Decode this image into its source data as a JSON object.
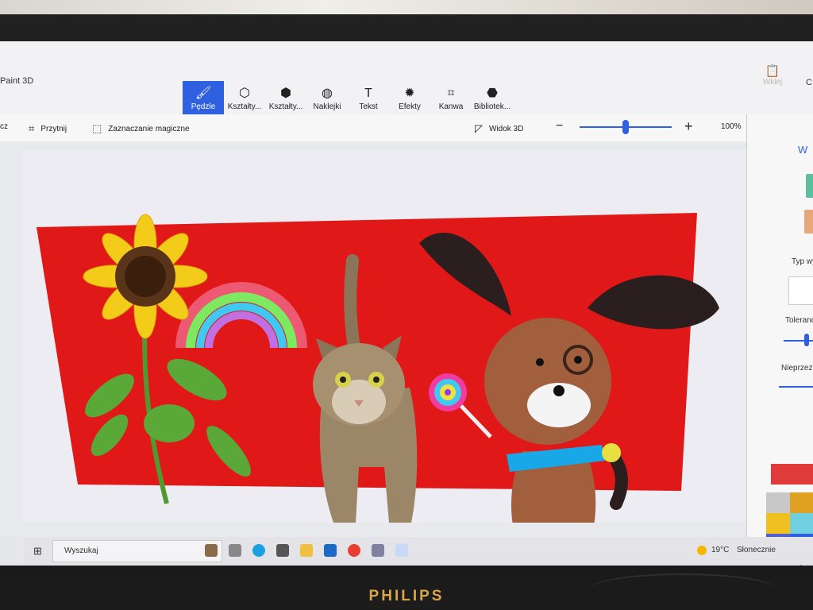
{
  "app": {
    "title": "Paint 3D"
  },
  "ribbon": {
    "tabs": [
      {
        "label": "Pędzle",
        "icon": "brush-icon",
        "glyph": "🖌",
        "active": true
      },
      {
        "label": "Kształty...",
        "icon": "2d-shapes-icon",
        "glyph": "⬡",
        "active": false
      },
      {
        "label": "Kształty...",
        "icon": "3d-shapes-icon",
        "glyph": "⬢",
        "active": false
      },
      {
        "label": "Naklejki",
        "icon": "sticker-icon",
        "glyph": "◍",
        "active": false
      },
      {
        "label": "Tekst",
        "icon": "text-icon",
        "glyph": "T",
        "active": false
      },
      {
        "label": "Efekty",
        "icon": "effects-icon",
        "glyph": "✹",
        "active": false
      },
      {
        "label": "Kanwa",
        "icon": "canvas-icon",
        "glyph": "⌗",
        "active": false
      },
      {
        "label": "Bibliotek...",
        "icon": "library-icon",
        "glyph": "⬣",
        "active": false
      }
    ],
    "paste_label": "Wklej",
    "edge_label": "C"
  },
  "toolbar": {
    "left_fragment": "cz",
    "crop_label": "Przytnij",
    "magic_select_label": "Zaznaczanie magiczne",
    "view3d_label": "Widok 3D",
    "zoom_value": "100%",
    "zoom_level": 0.5,
    "more_label": "···"
  },
  "panel": {
    "title": "W",
    "type_label": "Typ wy",
    "tolerance_label": "Toleranc",
    "opacity_label": "Nieprzezr",
    "add_label": "+",
    "colors": [
      "#e03a3a",
      "#c8c8c8",
      "#e0a020",
      "#e8d020",
      "#f0c020",
      "#70d0e0",
      "#38c8e8",
      "#5060d0",
      "#2f60e0"
    ]
  },
  "taskbar": {
    "search_placeholder": "Wyszukaj",
    "weather_temp": "19°C",
    "weather_text": "Słonecznie"
  },
  "monitor": {
    "brand": "PHILIPS"
  },
  "colors": {
    "accent": "#2f60e0",
    "canvas_red": "#e01818"
  }
}
